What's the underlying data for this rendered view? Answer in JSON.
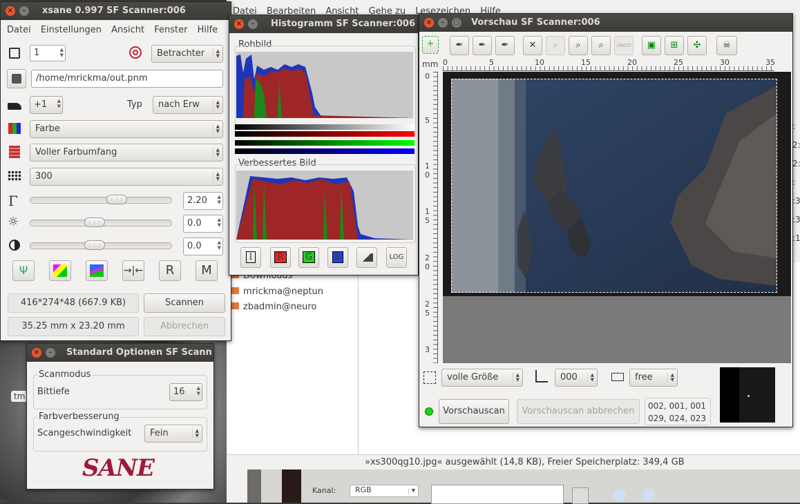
{
  "background_app": {
    "menu": [
      "Datei",
      "Bearbeiten",
      "Ansicht",
      "Gehe zu",
      "Lesezeichen",
      "Hilfe"
    ],
    "places": [
      "Downloads",
      "mrickma@neptun",
      "zbadmin@neuro"
    ],
    "status": "»xs300qg10.jpg« ausgewählt (14,8 KB), Freier Speicherplatz: 349,4 GB",
    "desktop_label": "tm",
    "bottom": {
      "kanal_label": "Kanal:",
      "kanal_value": "RGB"
    }
  },
  "xsane": {
    "title": "xsane 0.997 SF Scanner:006",
    "menu": [
      "Datei",
      "Einstellungen",
      "Ansicht",
      "Fenster",
      "Hilfe"
    ],
    "copies": "1",
    "viewer": "Betrachter",
    "filename": "/home/mrickma/out.pnm",
    "step": "+1",
    "typ_label": "Typ",
    "typ_value": "nach Erw",
    "mode": "Farbe",
    "range": "Voller Farbumfang",
    "resolution": "300",
    "gamma": "2.20",
    "brightness": "0.0",
    "contrast": "0.0",
    "image_info": "416*274*48 (667.9 KB)",
    "scan_button": "Scannen",
    "size_info": "35.25 mm x 23.20 mm",
    "cancel_button": "Abbrechen",
    "slider_levels": {
      "gamma": 0.63,
      "brightness": 0.45,
      "contrast": 0.45
    }
  },
  "histogram": {
    "title": "Histogramm SF Scanner:006",
    "raw_label": "Rohbild",
    "enhanced_label": "Verbessertes Bild",
    "buttons": [
      "I",
      "R",
      "G",
      "B",
      "",
      "LOG"
    ]
  },
  "preview": {
    "title": "Vorschau SF Scanner:006",
    "ruler_unit": "mm",
    "ruler_top": [
      "0",
      "5",
      "10",
      "15",
      "20",
      "25",
      "30",
      "35"
    ],
    "ruler_left": [
      "0",
      "5",
      "1",
      "0",
      "1",
      "5",
      "2",
      "0",
      "2",
      "5",
      "3"
    ],
    "size_combo": "volle Größe",
    "rotation_combo": "000",
    "aspect_combo": "free",
    "preview_button": "Vorschauscan",
    "cancel_preview_button": "Vorschauscan abbrechen",
    "rgb_line1": "002, 001, 001",
    "rgb_line2": "029, 024, 023",
    "side_numbers": [
      ":",
      "2:",
      "2:",
      ":",
      ":3",
      ":3",
      ":1"
    ]
  },
  "std_options": {
    "title": "Standard Optionen SF Scann",
    "group1": "Scanmodus",
    "depth_label": "Bittiefe",
    "depth_value": "16",
    "group2": "Farbverbesserung",
    "speed_label": "Scangeschwindigkeit",
    "speed_value": "Fein",
    "logo": "SANE"
  },
  "colors": {
    "accent_red": "#c6242f",
    "green_led": "#1fd01f"
  }
}
